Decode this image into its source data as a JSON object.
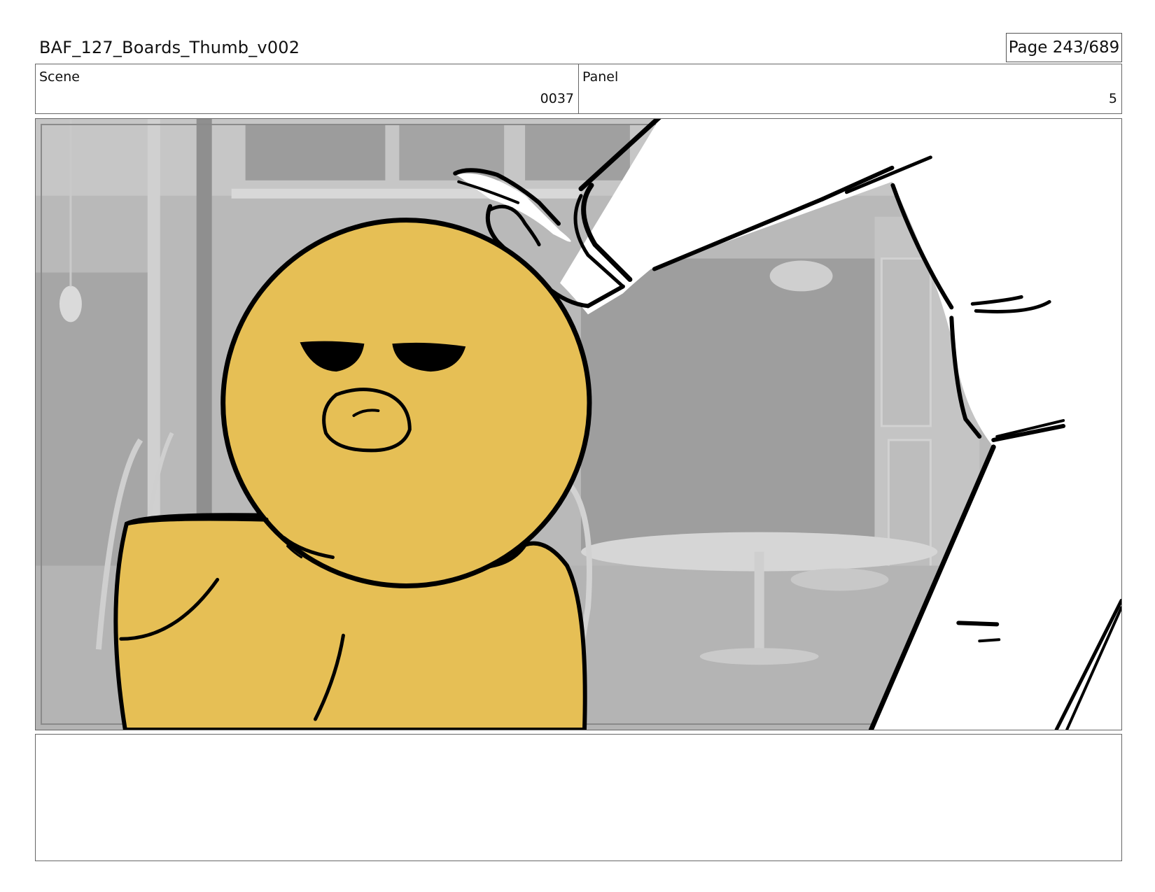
{
  "document": {
    "title": "BAF_127_Boards_Thumb_v002",
    "page_counter": "Page 243/689"
  },
  "scene": {
    "label": "Scene",
    "value": "0037"
  },
  "panel": {
    "label": "Panel",
    "value": "5"
  },
  "notes": {
    "text": ""
  },
  "colors": {
    "duck_fill": "#e6bf55",
    "line": "#000000",
    "background_grey": "#a8a8a8"
  }
}
